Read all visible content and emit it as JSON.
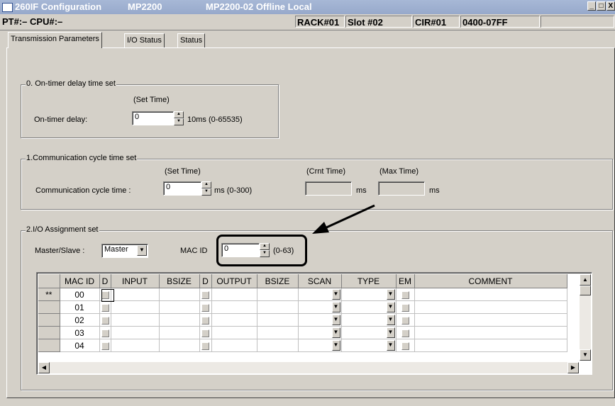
{
  "window": {
    "title": "260IF Configuration",
    "title_model": "MP2200",
    "title_status": "MP2200-02 Offline  Local",
    "min_icon": "_",
    "max_icon": "□",
    "close_icon": "X"
  },
  "statusbar": {
    "pt_cpu": "PT#:– CPU#:–",
    "rack": "RACK#01",
    "slot": "Slot #02",
    "cir": "CIR#01",
    "range": "0400-07FF",
    "extra": ""
  },
  "tabs": [
    {
      "label": "Transmission Parameters",
      "active": true
    },
    {
      "label": "I/O Status",
      "active": false
    },
    {
      "label": "Status",
      "active": false
    }
  ],
  "ontimer": {
    "group_title": "0. On-timer delay time set",
    "set_time_label": "(Set Time)",
    "field_label": "On-timer delay:",
    "value": "0",
    "unit": "10ms (0-65535)"
  },
  "comm": {
    "group_title": "1.Communication cycle time set",
    "set_time_label": "(Set Time)",
    "crnt_label": "(Crnt Time)",
    "max_label": "(Max Time)",
    "field_label": "Communication cycle time :",
    "value": "0",
    "unit": "ms (0-300)",
    "crnt_value": "",
    "crnt_unit": "ms",
    "max_value": "",
    "max_unit": "ms"
  },
  "io": {
    "group_title": "2.I/O Assignment set",
    "master_slave_label": "Master/Slave :",
    "master_slave_value": "Master",
    "mac_id_label": "MAC ID",
    "mac_id_value": "0",
    "mac_id_range": "(0-63)"
  },
  "grid": {
    "headers": [
      "",
      "MAC ID",
      "D",
      "INPUT",
      "BSIZE",
      "D",
      "OUTPUT",
      "BSIZE",
      "SCAN",
      "TYPE",
      "EM",
      "COMMENT"
    ],
    "rows": [
      {
        "marker": "**",
        "mac_id": "00"
      },
      {
        "marker": "",
        "mac_id": "01"
      },
      {
        "marker": "",
        "mac_id": "02"
      },
      {
        "marker": "",
        "mac_id": "03"
      },
      {
        "marker": "",
        "mac_id": "04"
      }
    ]
  },
  "icons": {
    "dropdown": "▼",
    "spin_up": "▲",
    "spin_down": "▼",
    "scroll_left": "◀",
    "scroll_right": "▶"
  }
}
